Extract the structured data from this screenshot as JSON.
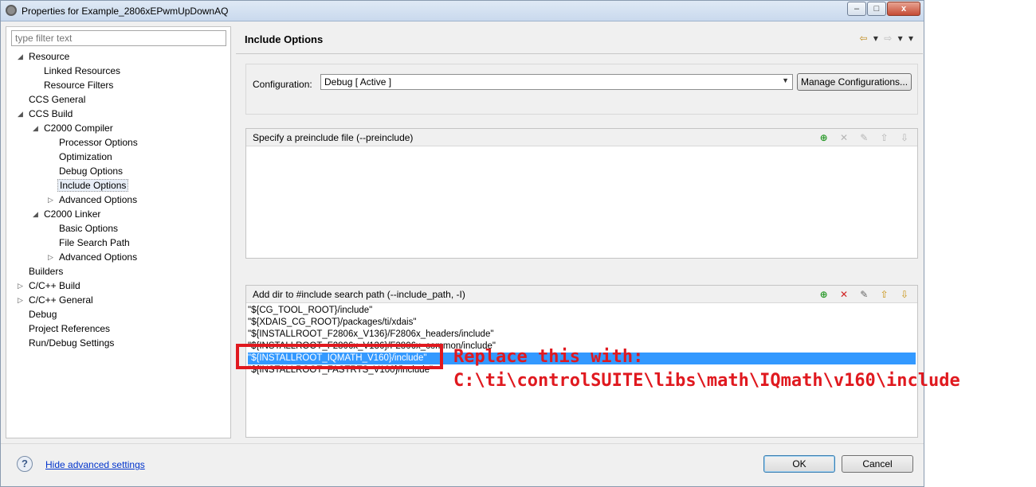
{
  "window": {
    "title": "Properties for Example_2806xEPwmUpDownAQ",
    "buttons": [
      "–",
      "□",
      "x"
    ]
  },
  "sidebar": {
    "filter_placeholder": "type filter text",
    "items": [
      {
        "label": "Resource",
        "twisty": "◢"
      },
      {
        "label": "Linked Resources"
      },
      {
        "label": "Resource Filters"
      },
      {
        "label": "CCS General"
      },
      {
        "label": "CCS Build",
        "twisty": "◢"
      },
      {
        "label": "C2000 Compiler",
        "twisty": "◢"
      },
      {
        "label": "Processor Options"
      },
      {
        "label": "Optimization"
      },
      {
        "label": "Debug Options"
      },
      {
        "label": "Include Options"
      },
      {
        "label": "Advanced Options",
        "twisty": "▷"
      },
      {
        "label": "C2000 Linker",
        "twisty": "◢"
      },
      {
        "label": "Basic Options"
      },
      {
        "label": "File Search Path"
      },
      {
        "label": "Advanced Options",
        "twisty": "▷"
      },
      {
        "label": "Builders"
      },
      {
        "label": "C/C++ Build",
        "twisty": "▷"
      },
      {
        "label": "C/C++ General",
        "twisty": "▷"
      },
      {
        "label": "Debug"
      },
      {
        "label": "Project References"
      },
      {
        "label": "Run/Debug Settings"
      }
    ]
  },
  "main": {
    "title": "Include Options",
    "nav": {
      "back": "⇦",
      "back_menu": "▾",
      "forward": "⇨",
      "forward_menu": "▾",
      "view_menu": "▾"
    },
    "configuration": {
      "label": "Configuration:",
      "value": "Debug  [ Active ]",
      "manage_button": "Manage Configurations..."
    },
    "preinclude": {
      "title": "Specify a preinclude file (--preinclude)"
    },
    "include_path": {
      "title": "Add dir to #include search path (--include_path, -I)",
      "items": [
        "\"${CG_TOOL_ROOT}/include\"",
        "\"${XDAIS_CG_ROOT}/packages/ti/xdais\"",
        "\"${INSTALLROOT_F2806x_V136}/F2806x_headers/include\"",
        "\"${INSTALLROOT_F2806x_V136}/F2806x_common/include\"",
        "\"${INSTALLROOT_IQMATH_V160}/include\"",
        "\"${INSTALLROOT_FASTRTS_V100}/include\""
      ],
      "selected_index": 4
    }
  },
  "footer": {
    "help": "?",
    "hide_advanced": "Hide advanced settings",
    "ok": "OK",
    "cancel": "Cancel"
  },
  "annotation": {
    "line1": "Replace this with:",
    "line2": "C:\\ti\\controlSUITE\\libs\\math\\IQmath\\v160\\include",
    "color": "#e0191f"
  },
  "colors": {
    "selection": "#3399ff",
    "link": "#0033cc"
  }
}
